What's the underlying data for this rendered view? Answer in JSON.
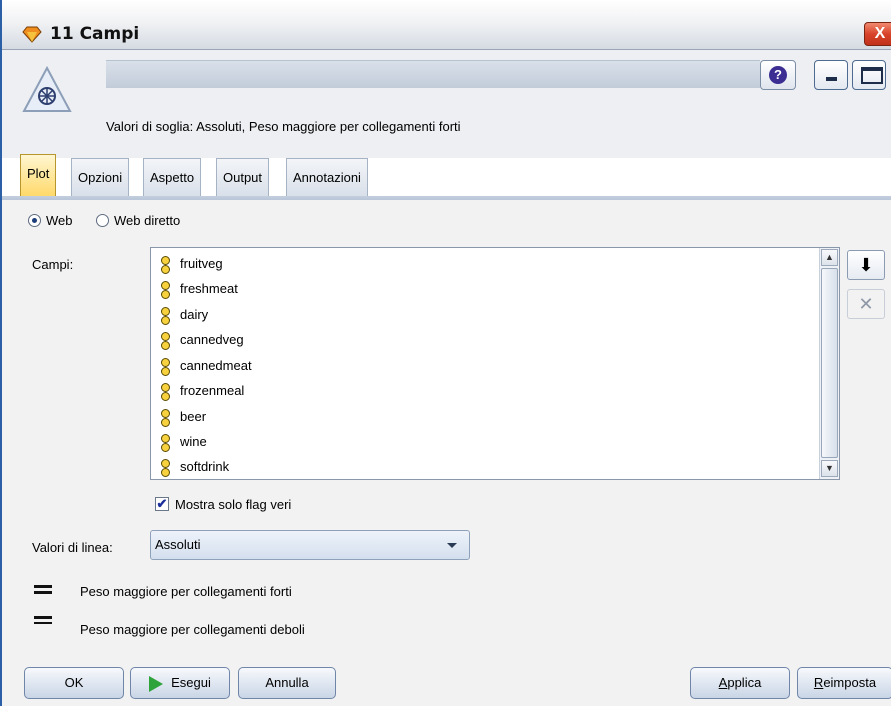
{
  "window": {
    "title": "11 Campi",
    "close_glyph": "X",
    "node_icon": "web-node-icon",
    "summary": "Valori di soglia: Assoluti,  Peso maggiore per collegamenti forti",
    "name_value": ""
  },
  "toolbar": {
    "help_glyph": "?"
  },
  "tabs": [
    {
      "label": "Plot",
      "active": true
    },
    {
      "label": "Opzioni",
      "active": false
    },
    {
      "label": "Aspetto",
      "active": false
    },
    {
      "label": "Output",
      "active": false
    },
    {
      "label": "Annotazioni",
      "active": false
    }
  ],
  "plot": {
    "radio_web": {
      "label": "Web",
      "selected": true
    },
    "radio_directed": {
      "label": "Web diretto",
      "selected": false
    },
    "fields_label": "Campi:",
    "fields": [
      "fruitveg",
      "freshmeat",
      "dairy",
      "cannedveg",
      "cannedmeat",
      "frozenmeal",
      "beer",
      "wine",
      "softdrink"
    ],
    "scroll_up_glyph": "▲",
    "scroll_down_glyph": "▼",
    "field_picker_glyph": "⬇",
    "remove_glyph": "✕",
    "only_true_flags": {
      "label": "Mostra solo flag veri",
      "checked": true,
      "check_glyph": "✔"
    },
    "line_values_label": "Valori di linea:",
    "line_values_selected": "Assoluti",
    "legend_strong": "Peso maggiore per collegamenti forti",
    "legend_weak": "Peso maggiore per collegamenti deboli"
  },
  "buttons": {
    "ok": "OK",
    "run": "Esegui",
    "cancel": "Annulla",
    "apply": "Applica",
    "reset": "Reimposta"
  },
  "colors": {
    "accent": "#2b5fa6",
    "active_tab": "#ffd96a",
    "run_icon": "#2ea33a"
  }
}
